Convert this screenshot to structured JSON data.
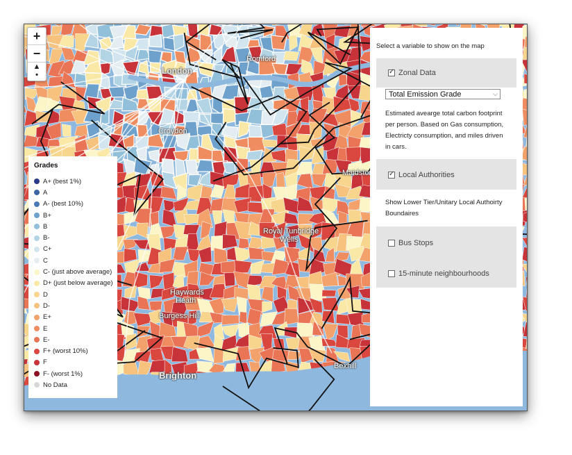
{
  "map": {
    "controls": {
      "zoom_in": "+",
      "zoom_out": "−",
      "reset": "▲\n•"
    },
    "place_labels": [
      {
        "id": "romford",
        "text": "Romford"
      },
      {
        "id": "london",
        "text": "London"
      },
      {
        "id": "croydon",
        "text": "Croydon"
      },
      {
        "id": "maidstone",
        "text": "Maidstone"
      },
      {
        "id": "tunbridge1",
        "text": "Royal Tunbridge"
      },
      {
        "id": "tunbridge2",
        "text": "Wells"
      },
      {
        "id": "haywards1",
        "text": "Haywards"
      },
      {
        "id": "haywards2",
        "text": "Heath"
      },
      {
        "id": "burgess",
        "text": "Burgess Hill"
      },
      {
        "id": "brighton",
        "text": "Brighton"
      },
      {
        "id": "bexhill",
        "text": "Bexhill"
      }
    ]
  },
  "legend": {
    "title": "Grades",
    "items": [
      {
        "label": "A+ (best 1%)",
        "color": "#2a3a8c"
      },
      {
        "label": "A",
        "color": "#3a66a8"
      },
      {
        "label": "A- (best 10%)",
        "color": "#4a7ab6"
      },
      {
        "label": "B+",
        "color": "#6ea2cc"
      },
      {
        "label": "B",
        "color": "#92bfd9"
      },
      {
        "label": "B-",
        "color": "#b3d4e5"
      },
      {
        "label": "C+",
        "color": "#d3e6ef"
      },
      {
        "label": "C",
        "color": "#e4eef2"
      },
      {
        "label": "C- (just above average)",
        "color": "#fbf5c8"
      },
      {
        "label": "D+ (just below average)",
        "color": "#fae8a6"
      },
      {
        "label": "D",
        "color": "#f8d58c"
      },
      {
        "label": "D-",
        "color": "#f6c27e"
      },
      {
        "label": "E+",
        "color": "#f3a26c"
      },
      {
        "label": "E",
        "color": "#ef8d60"
      },
      {
        "label": "E-",
        "color": "#e97556"
      },
      {
        "label": "F+ (worst 10%)",
        "color": "#d9473e"
      },
      {
        "label": "F",
        "color": "#c8333a"
      },
      {
        "label": "F- (worst 1%)",
        "color": "#8c1022"
      },
      {
        "label": "No Data",
        "color": "#d8d8d8"
      }
    ]
  },
  "panel": {
    "intro": "Select a variable to show on the map",
    "zonal": {
      "label": "Zonal Data",
      "checked": true,
      "select_value": "Total Emission Grade",
      "description": [
        "Estimated avearge total carbon footprint",
        "per person. Based on Gas consumption,",
        "Electricty consumption, and miles driven",
        "in cars."
      ]
    },
    "local_authorities": {
      "label": "Local Authorities",
      "checked": true,
      "description": [
        "Show Lower Tier/Unitary Local Authoirty",
        "Boundaires"
      ]
    },
    "bus_stops": {
      "label": "Bus Stops",
      "checked": false
    },
    "neighbourhoods": {
      "label": "15-minute neighbourhoods",
      "checked": false
    }
  }
}
